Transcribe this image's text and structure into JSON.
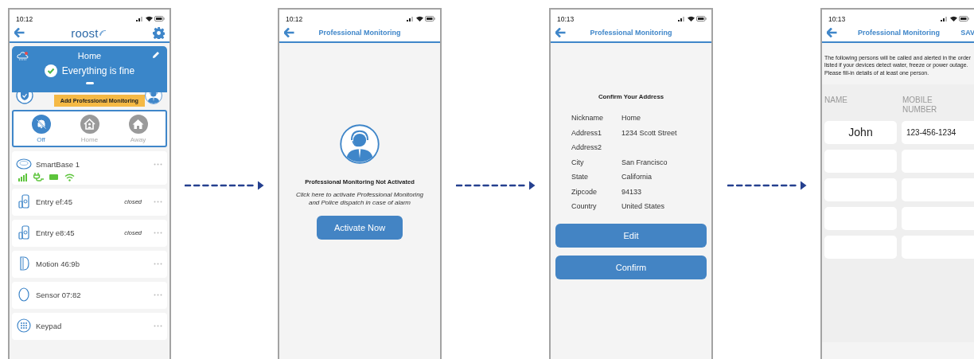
{
  "screens": [
    {
      "kind": "home",
      "time": "10:12",
      "logo": "roost",
      "banner": {
        "title": "Home",
        "status": "Everything is fine"
      },
      "promo": "Add Professional Monitoring",
      "modes": [
        {
          "label": "Off",
          "kind": "off",
          "selected": true
        },
        {
          "label": "Home",
          "kind": "home",
          "selected": false
        },
        {
          "label": "Away",
          "kind": "away",
          "selected": false
        }
      ],
      "devices": [
        {
          "name": "SmartBase 1",
          "kind": "base"
        },
        {
          "name": "Entry ef:45",
          "kind": "entry",
          "state": "closed"
        },
        {
          "name": "Entry e8:45",
          "kind": "entry",
          "state": "closed"
        },
        {
          "name": "Motion 46:9b",
          "kind": "motion"
        },
        {
          "name": "Sensor 07:82",
          "kind": "sensor"
        },
        {
          "name": "Keypad",
          "kind": "keypad"
        }
      ]
    },
    {
      "kind": "notice",
      "time": "10:12",
      "title": "Professional Monitoring",
      "heading": "Professional Monitoring Not Activated",
      "message": "Click here to activate Professional Monitoring and Police dispatch in case of alarm",
      "button": "Activate Now"
    },
    {
      "kind": "address",
      "time": "10:13",
      "title": "Professional Monitoring",
      "heading": "Confirm Your Address",
      "fields": [
        {
          "label": "Nickname",
          "value": "Home"
        },
        {
          "label": "Address1",
          "value": "1234 Scott Street"
        },
        {
          "label": "Address2"
        },
        {
          "label": "City",
          "value": "San Francisco"
        },
        {
          "label": "State",
          "value": "California"
        },
        {
          "label": "Zipcode",
          "value": "94133"
        },
        {
          "label": "Country",
          "value": "United States"
        }
      ],
      "buttons": [
        "Edit",
        "Confirm"
      ]
    },
    {
      "kind": "contacts",
      "time": "10:13",
      "title": "Professional Monitoring",
      "action": "SAV",
      "intro": "The following persons will be called and alerted in the order listed if your devices detect water, freeze or power outage. Please fill-in details of at least one person.",
      "columns": [
        "NAME",
        "MOBILE NUMBER"
      ],
      "rows": [
        {
          "name": "John",
          "mobile": "123-456-1234"
        },
        {},
        {},
        {},
        {}
      ]
    }
  ]
}
